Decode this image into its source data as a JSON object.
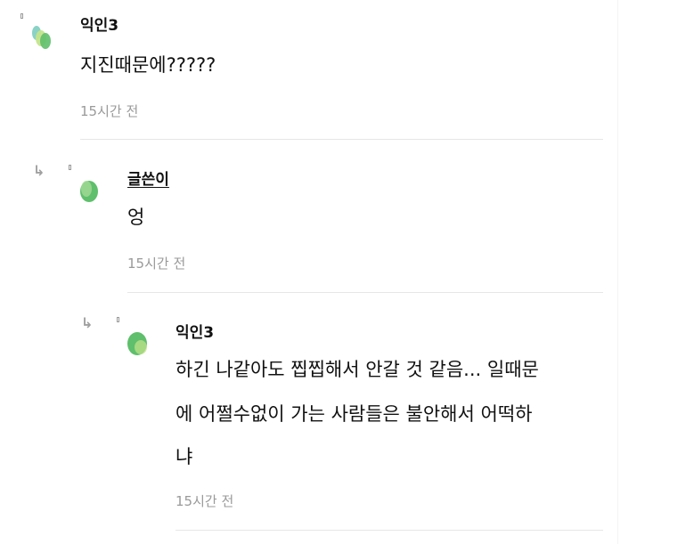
{
  "comments": [
    {
      "author": "익인3",
      "body_lines": [
        "지진때문에?????"
      ],
      "time": "15시간 전"
    },
    {
      "author": "글쓴이",
      "body_lines": [
        "엉"
      ],
      "time": "15시간 전"
    },
    {
      "author": "익인3",
      "body_lines": [
        "하긴 나같아도 찝찝해서 안갈 것 같음... 일때문",
        "에 어쩔수없이 가는 사람들은 불안해서 어떡하",
        "냐"
      ],
      "time": "15시간 전"
    }
  ],
  "icons": {
    "reply": "reply-arrow-icon",
    "avatar": "avatar-icon",
    "marker": "comment-marker-icon"
  },
  "colors": {
    "text": "#111111",
    "muted": "#9a9a9a",
    "divider": "#e6e6e6",
    "avatar_green": "#5fbf6c",
    "avatar_light_green": "#a8dc9a",
    "avatar_teal": "#7ccdbf"
  }
}
